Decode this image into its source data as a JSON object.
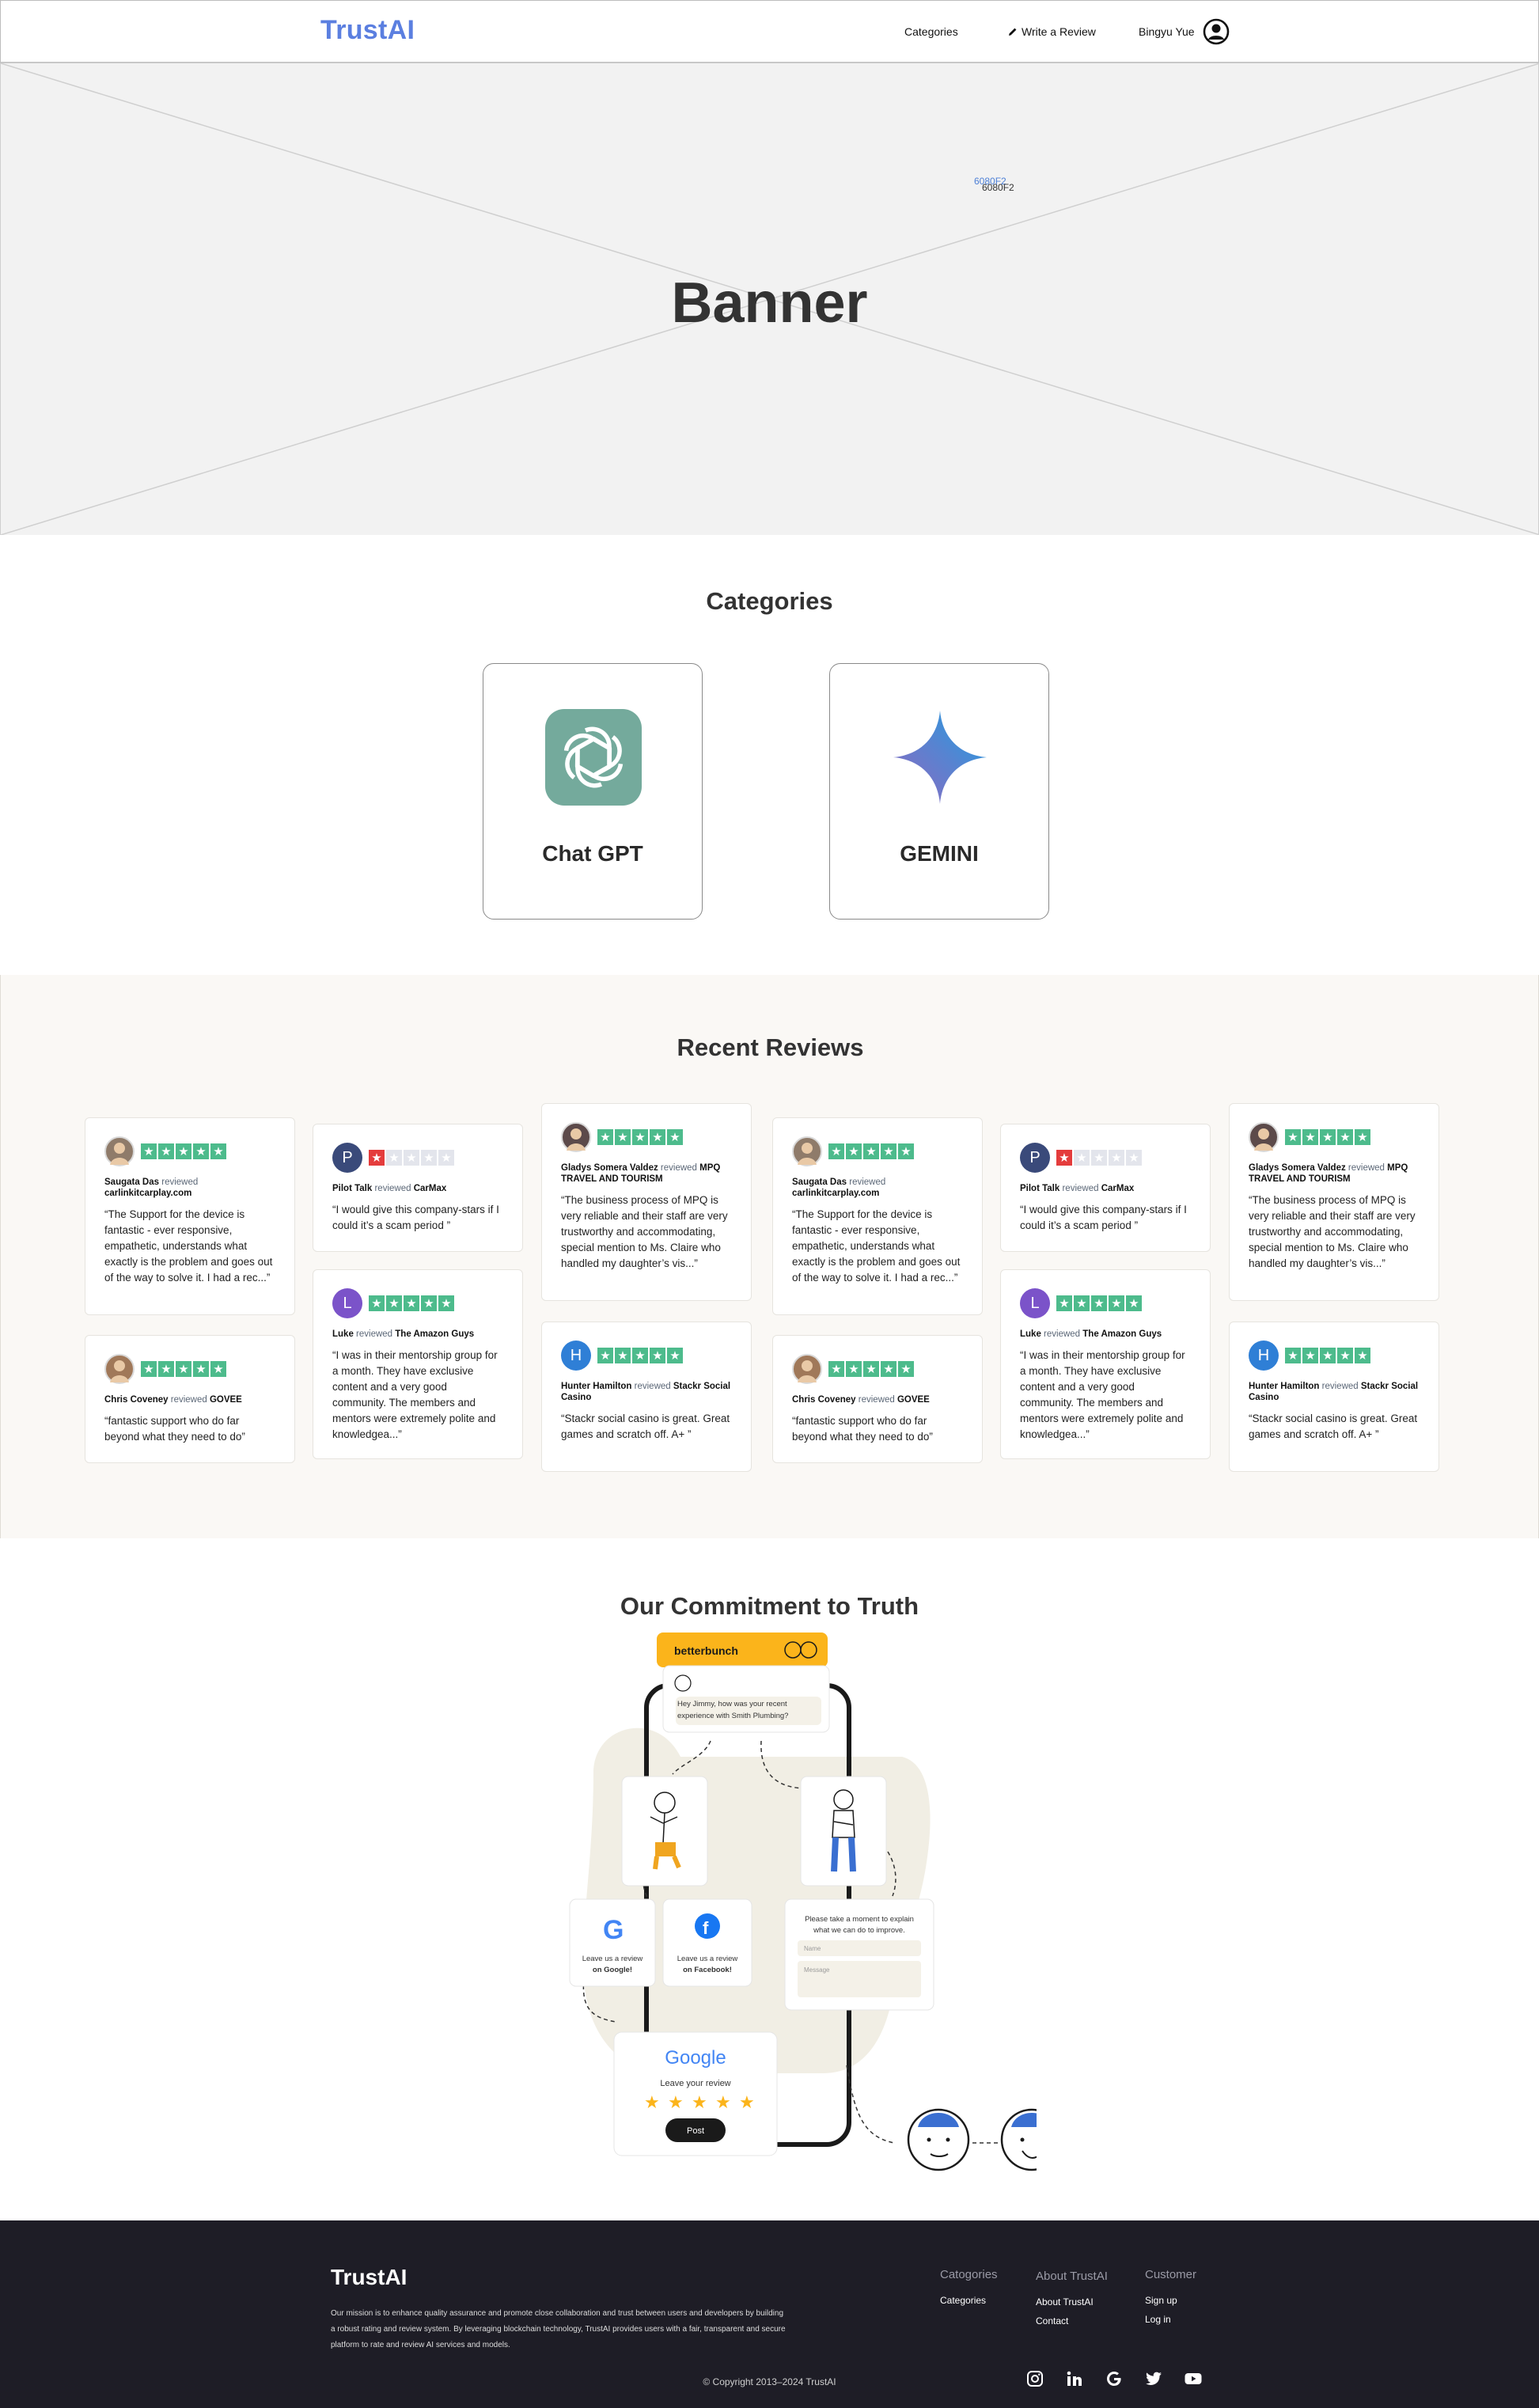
{
  "nav": {
    "logo": "TrustAI",
    "categories": "Categories",
    "write_review": "Write a Review",
    "user_name": "Bingyu Yue"
  },
  "banner": {
    "title": "Banner",
    "code_a": "6080F2",
    "code_b": "6080F2"
  },
  "categories": {
    "title": "Categories",
    "items": [
      {
        "label": "Chat GPT",
        "icon": "chatgpt-logo-icon",
        "color": "#74aa9c"
      },
      {
        "label": "GEMINI",
        "icon": "gemini-star-icon",
        "color": "#5b7fe0"
      }
    ]
  },
  "reviews": {
    "title": "Recent Reviews",
    "reviewed_word": "reviewed",
    "items": [
      {
        "name": "Saugata Das",
        "company": "carlinkitcarplay.com",
        "rating": 5,
        "avatar": "photo",
        "text": "“The Support for the device is fantastic - ever responsive, empathetic, understands what exactly is the problem and goes out of the way to solve it. I had a rec...”"
      },
      {
        "name": "Chris Coveney",
        "company": "GOVEE",
        "rating": 5,
        "avatar": "photo",
        "text": "“fantastic support who do far beyond what they need to do”"
      },
      {
        "name": "Pilot Talk",
        "company": "CarMax",
        "rating": 1,
        "avatar": "P",
        "text": "“I would give this company-stars if I could it’s a scam period ”"
      },
      {
        "name": "Luke",
        "company": "The Amazon Guys",
        "rating": 5,
        "avatar": "L",
        "text": "“I was in their mentorship group for a month. They have exclusive content and a very good community. The members and mentors were extremely polite and knowledgea...”"
      },
      {
        "name": "Gladys Somera Valdez",
        "company": "MPQ TRAVEL AND TOURISM",
        "rating": 5,
        "avatar": "photo",
        "text": "“The business process of MPQ is very reliable and their staff are very trustworthy and accommodating, special mention to Ms. Claire who handled my daughter’s vis...”"
      },
      {
        "name": "Hunter Hamilton",
        "company": "Stackr Social Casino",
        "rating": 5,
        "avatar": "H",
        "text": "“Stackr social casino is great. Great games and scratch off. A+ ”"
      }
    ]
  },
  "commitment": {
    "title": "Our Commitment to Truth",
    "app_name": "betterbunch",
    "chat_message": "Hey Jimmy, how was your recent experience with Smith Plumbing?",
    "google_prompt_line1": "Leave us a review",
    "google_prompt_line2": "on Google!",
    "facebook_prompt_line1": "Leave us a review",
    "facebook_prompt_line2": "on Facebook!",
    "feedback_prompt_line1": "Please take a moment to explain",
    "feedback_prompt_line2": "what we can do to improve.",
    "name_placeholder": "Name",
    "message_placeholder": "Message",
    "google_word": "Google",
    "leave_review": "Leave your review",
    "post_button": "Post"
  },
  "footer": {
    "logo": "TrustAI",
    "mission": "Our mission is to enhance quality assurance and promote close collaboration and trust between users and developers by building a robust rating and review system. By leveraging blockchain technology, TrustAI provides users with a fair, transparent and secure platform to rate and review AI services and models.",
    "col1_heading": "Catogories",
    "col1_items": [
      "Categories"
    ],
    "col2_heading": "About TrustAI",
    "col2_items": [
      "About TrustAI",
      "Contact"
    ],
    "col3_heading": "Customer",
    "col3_items": [
      "Sign up",
      "Log in"
    ],
    "copyright": "© Copyright 2013–2024 TrustAI",
    "social": [
      "instagram-icon",
      "linkedin-icon",
      "google-icon",
      "twitter-icon",
      "youtube-icon"
    ]
  },
  "colors": {
    "brand": "#5b7fe0",
    "star_green": "#4dbb8c",
    "star_red": "#e43c3c",
    "footer_bg": "#1e1d26"
  }
}
